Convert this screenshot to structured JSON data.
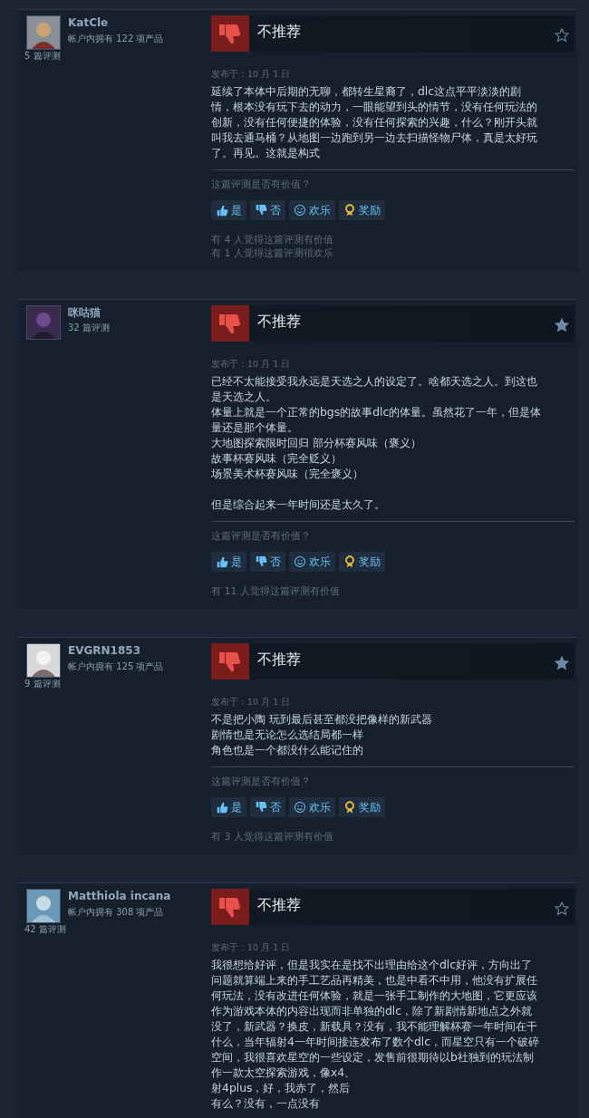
{
  "reviews": [
    {
      "author": "KatCle",
      "products": "帐户内拥有 122 项产品",
      "review_count": "5 篇评测",
      "verdict": "不推荐",
      "starred": false,
      "posted": "发布于：10 月 1 日",
      "paragraphs": [
        [
          "延续了本体中后期的无聊，都转生星裔了，dlc这点平平淡淡的剧",
          "情，根本没有玩下去的动力，一眼能望到头的情节，没有任何玩法的",
          "创新，没有任何便捷的体验，没有任何探索的兴趣，什么？刚开头就",
          "叫我去通马桶？从地图一边跑到另一边去扫描怪物尸体，真是太好玩",
          "了。再见。这就是构式"
        ]
      ],
      "helpful_prompt": "这篇评测是否有价值？",
      "buttons": [
        {
          "kind": "yes",
          "label": "是"
        },
        {
          "kind": "no",
          "label": "否"
        },
        {
          "kind": "funny",
          "label": "欢乐"
        },
        {
          "kind": "award",
          "label": "奖励"
        }
      ],
      "stats": [
        "有 4 人觉得这篇评测有价值",
        "有 1 人觉得这篇评测很欢乐"
      ]
    },
    {
      "author": "咪咕猫",
      "review_count": "32 篇评测",
      "verdict": "不推荐",
      "starred": true,
      "posted": "发布于：10 月 1 日",
      "paragraphs": [
        [
          "已经不太能接受我永远是天选之人的设定了。啥都天选之人。到这也",
          "是天选之人。",
          "体量上就是一个正常的bgs的故事dlc的体量。虽然花了一年，但是体",
          "量还是那个体量。",
          "大地图探索限时回归 部分杯赛风味（褒义）",
          "故事杯赛风味（完全贬义）",
          "场景美术杯赛风味（完全褒义）"
        ],
        [
          "但是综合起来一年时间还是太久了。"
        ]
      ],
      "helpful_prompt": "这篇评测是否有价值？",
      "buttons": [
        {
          "kind": "yes",
          "label": "是"
        },
        {
          "kind": "no",
          "label": "否"
        },
        {
          "kind": "funny",
          "label": "欢乐"
        },
        {
          "kind": "award",
          "label": "奖励"
        }
      ],
      "stats": [
        "有 11 人觉得这篇评测有价值"
      ]
    },
    {
      "author": "EVGRN1853",
      "products": "帐户内拥有 125 项产品",
      "review_count": "9 篇评测",
      "verdict": "不推荐",
      "starred": true,
      "posted": "发布于：10 月 1 日",
      "paragraphs": [
        [
          "不是把小陶 玩到最后甚至都没把像样的新武器",
          "剧情也是无论怎么选结局都一样",
          "角色也是一个都没什么能记住的"
        ]
      ],
      "helpful_prompt": "这篇评测是否有价值？",
      "buttons": [
        {
          "kind": "yes",
          "label": "是"
        },
        {
          "kind": "no",
          "label": "否"
        },
        {
          "kind": "funny",
          "label": "欢乐"
        },
        {
          "kind": "award",
          "label": "奖励"
        }
      ],
      "stats": [
        "有 3 人觉得这篇评测有价值"
      ]
    },
    {
      "author": "Matthiola incana",
      "products": "帐户内拥有 308 项产品",
      "review_count": "42 篇评测",
      "verdict": "不推荐",
      "starred": false,
      "posted": "发布于：10 月 1 日",
      "paragraphs": [
        [
          "我很想给好评，但是我实在是找不出理由给这个dlc好评，方向出了",
          "问题就算端上来的手工艺品再精美，也是中看不中用，他没有扩展任",
          "何玩法，没有改进任何体验，就是一张手工制作的大地图，它更应该",
          "作为游戏本体的内容出现而非单独的dlc，除了新剧情新地点之外就",
          "没了，新武器？换皮，新载具？没有，我不能理解杯赛一年时间在干",
          "什么，当年辐射4一年时间接连发布了数个dlc，而星空只有一个破碎",
          "空间，我很喜欢星空的一些设定，发售前很期待以b社独到的玩法制",
          "作一款太空探索游戏，像x4、",
          "射4plus，好，我赤了，然后",
          "有么？没有，一点没有"
        ]
      ]
    }
  ]
}
